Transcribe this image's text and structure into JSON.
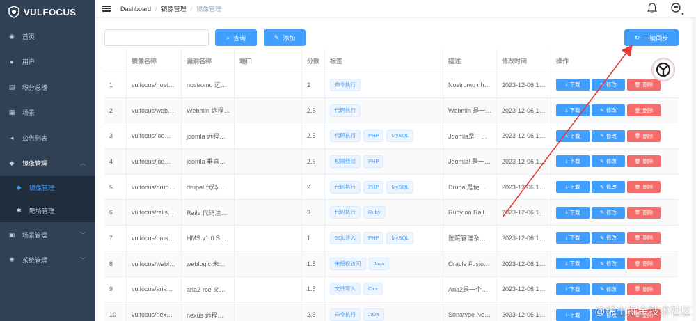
{
  "app": {
    "logo_text": "VULFOCUS"
  },
  "sidebar": {
    "items": [
      {
        "label": "首页",
        "icon": "dashboard-icon"
      },
      {
        "label": "用户",
        "icon": "user-icon"
      },
      {
        "label": "积分总榜",
        "icon": "ranking-icon"
      },
      {
        "label": "场景",
        "icon": "table-icon"
      },
      {
        "label": "公告列表",
        "icon": "notice-icon"
      },
      {
        "label": "镜像管理",
        "icon": "image-icon"
      }
    ],
    "submenu": [
      {
        "label": "镜像管理",
        "icon": "docker-icon"
      },
      {
        "label": "靶场管理",
        "icon": "bug-icon"
      }
    ],
    "bottom_items": [
      {
        "label": "场景管理",
        "icon": "scene-icon"
      },
      {
        "label": "系统管理",
        "icon": "settings-icon"
      }
    ]
  },
  "breadcrumb": {
    "items": [
      "Dashboard",
      "镜像管理",
      "镜像管理"
    ]
  },
  "toolbar": {
    "search_placeholder": "",
    "query_label": "查询",
    "add_label": "添加",
    "sync_label": "一键同步"
  },
  "table": {
    "columns": [
      "",
      "镜像名称",
      "漏洞名称",
      "端口",
      "分数",
      "标签",
      "描述",
      "修改时间",
      "操作"
    ],
    "ops": {
      "download": "下载",
      "edit": "修改",
      "delete": "删除"
    },
    "rows": [
      {
        "idx": "1",
        "name": "vulfocus/nost…",
        "vuln": "nostromo 远…",
        "port": "",
        "score": "2",
        "tags": [
          "命令执行"
        ],
        "desc": "Nostromo nh…",
        "time": "2023-12-06 1…"
      },
      {
        "idx": "2",
        "name": "vulfocus/web…",
        "vuln": "Webmin 远程…",
        "port": "",
        "score": "2.5",
        "tags": [
          "代码执行"
        ],
        "desc": "Webmin 是一…",
        "time": "2023-12-06 1…"
      },
      {
        "idx": "3",
        "name": "vulfocus/joo…",
        "vuln": "joomla 远程…",
        "port": "",
        "score": "2.5",
        "tags": [
          "代码执行",
          "PHP",
          "MySQL"
        ],
        "desc": "Joomla是一…",
        "time": "2023-12-06 1…"
      },
      {
        "idx": "4",
        "name": "vulfocus/joo…",
        "vuln": "joomla 垂直…",
        "port": "",
        "score": "2.5",
        "tags": [
          "权限绕过",
          "PHP"
        ],
        "desc": "Joomla! 是一…",
        "time": "2023-12-06 1…"
      },
      {
        "idx": "5",
        "name": "vulfocus/drup…",
        "vuln": "drupal 代码…",
        "port": "",
        "score": "2",
        "tags": [
          "代码执行",
          "PHP",
          "MySQL"
        ],
        "desc": "Drupal是使…",
        "time": "2023-12-06 1…"
      },
      {
        "idx": "6",
        "name": "vulfocus/rails…",
        "vuln": "Rails 代码注…",
        "port": "",
        "score": "3",
        "tags": [
          "代码执行",
          "Ruby"
        ],
        "desc": "Ruby on Rail…",
        "time": "2023-12-06 1…"
      },
      {
        "idx": "7",
        "name": "vulfocus/hms…",
        "vuln": "HMS v1.0 S…",
        "port": "",
        "score": "1",
        "tags": [
          "SQL注入",
          "PHP",
          "MySQL"
        ],
        "desc": "医院管理系…",
        "time": "2023-12-06 1…"
      },
      {
        "idx": "8",
        "name": "vulfocus/webl…",
        "vuln": "weblogic 未…",
        "port": "",
        "score": "1.5",
        "tags": [
          "未授权访问",
          "Java"
        ],
        "desc": "Oracle Fusio…",
        "time": "2023-12-06 1…"
      },
      {
        "idx": "9",
        "name": "vulfocus/aria…",
        "vuln": "aria2-rce 文…",
        "port": "",
        "score": "1.5",
        "tags": [
          "文件写入",
          "C++"
        ],
        "desc": "Aria2是一个…",
        "time": "2023-12-06 1…"
      },
      {
        "idx": "10",
        "name": "vulfocus/nex…",
        "vuln": "nexus 远程…",
        "port": "",
        "score": "2.5",
        "tags": [
          "命令执行",
          "Java"
        ],
        "desc": "Sonatype Ne…",
        "time": "2023-12-06 1…"
      }
    ]
  },
  "watermark": "@稀土掘金技术社区",
  "colors": {
    "sidebar_bg": "#304156",
    "primary": "#409eff",
    "danger": "#f56c6c",
    "arrow": "#e53935"
  }
}
